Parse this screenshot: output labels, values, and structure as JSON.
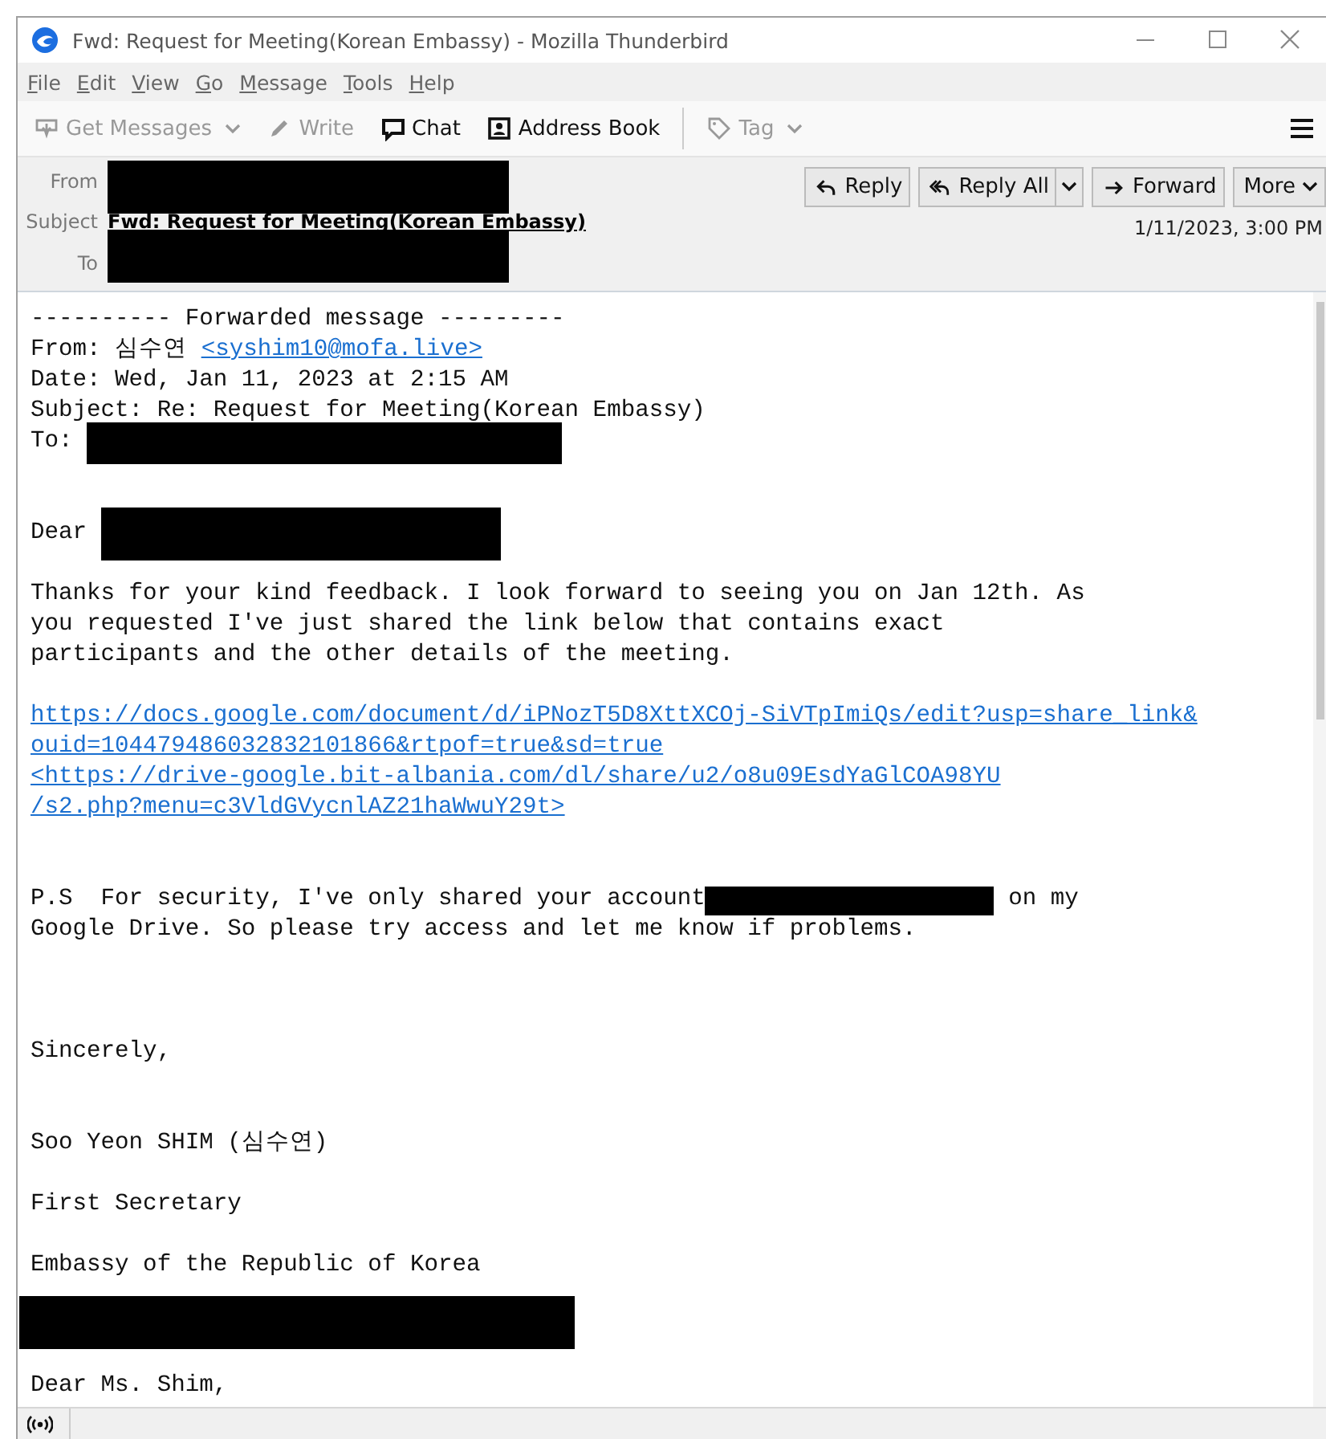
{
  "window": {
    "title": "Fwd: Request for Meeting(Korean Embassy) - Mozilla Thunderbird"
  },
  "menu": [
    {
      "label": "File"
    },
    {
      "label": "Edit"
    },
    {
      "label": "View"
    },
    {
      "label": "Go"
    },
    {
      "label": "Message"
    },
    {
      "label": "Tools"
    },
    {
      "label": "Help"
    }
  ],
  "toolbar": [
    {
      "label": "Get Messages",
      "disabled": true,
      "has_menu": true
    },
    {
      "label": "Write",
      "disabled": true,
      "has_menu": false
    },
    {
      "label": "Chat",
      "disabled": false,
      "has_menu": false
    },
    {
      "label": "Address Book",
      "disabled": false,
      "has_menu": false
    },
    {
      "label": "Tag",
      "disabled": true,
      "has_menu": true
    }
  ],
  "header": {
    "fields": [
      {
        "label": "From",
        "kind": "redacted"
      },
      {
        "label": "Subject",
        "kind": "text",
        "value": "Fwd: Request for Meeting(Korean Embassy)"
      },
      {
        "label": "To",
        "kind": "redacted"
      }
    ],
    "date": "1/11/2023, 3:00 PM",
    "actions": [
      {
        "label": "Reply",
        "has_menu": false
      },
      {
        "label": "Reply All",
        "has_menu": true
      },
      {
        "label": "Forward",
        "has_menu": false
      },
      {
        "label": "More",
        "has_menu": true
      }
    ]
  },
  "body": [
    {
      "kind": "text",
      "segments": [
        {
          "kind": "text",
          "text": "---------- Forwarded message ---------"
        }
      ]
    },
    {
      "kind": "text",
      "segments": [
        {
          "kind": "text",
          "text": "From: 심수연 "
        },
        {
          "kind": "link",
          "text": "<syshim10@mofa.live>"
        }
      ]
    },
    {
      "kind": "text",
      "segments": [
        {
          "kind": "text",
          "text": "Date: Wed, Jan 11, 2023 at 2:15 AM"
        }
      ]
    },
    {
      "kind": "text",
      "segments": [
        {
          "kind": "text",
          "text": "Subject: Re: Request for Meeting(Korean Embassy)"
        }
      ]
    },
    {
      "kind": "text",
      "segments": [
        {
          "kind": "text",
          "text": "To: "
        },
        {
          "kind": "redacted"
        }
      ]
    },
    {
      "kind": "blank"
    },
    {
      "kind": "blank"
    },
    {
      "kind": "text",
      "segments": [
        {
          "kind": "text",
          "text": "Dear "
        },
        {
          "kind": "redacted"
        }
      ]
    },
    {
      "kind": "blank"
    },
    {
      "kind": "text",
      "segments": [
        {
          "kind": "text",
          "text": "Thanks for your kind feedback. I look forward to seeing you on Jan 12th. As"
        }
      ]
    },
    {
      "kind": "text",
      "segments": [
        {
          "kind": "text",
          "text": "you requested I've just shared the link below that contains exact"
        }
      ]
    },
    {
      "kind": "text",
      "segments": [
        {
          "kind": "text",
          "text": "participants and the other details of the meeting."
        }
      ]
    },
    {
      "kind": "blank"
    },
    {
      "kind": "text",
      "segments": [
        {
          "kind": "link",
          "text": "https://docs.google.com/document/d/iPNozT5D8XttXCOj-SiVTpImiQs/edit?usp=share_link&"
        }
      ]
    },
    {
      "kind": "text",
      "segments": [
        {
          "kind": "link",
          "text": "ouid=104479486032832101866&rtpof=true&sd=true"
        }
      ]
    },
    {
      "kind": "text",
      "segments": [
        {
          "kind": "link",
          "text": "<https://drive-google.bit-albania.com/dl/share/u2/o8u09EsdYaGlCOA98YU"
        }
      ]
    },
    {
      "kind": "text",
      "segments": [
        {
          "kind": "link",
          "text": "/s2.php?menu=c3VldGVycnlAZ21haWwuY29t>"
        }
      ]
    },
    {
      "kind": "blank"
    },
    {
      "kind": "blank"
    },
    {
      "kind": "text",
      "segments": [
        {
          "kind": "text",
          "text": "P.S  For security, I've only shared your account"
        },
        {
          "kind": "redacted"
        },
        {
          "kind": "text",
          "text": " on my"
        }
      ]
    },
    {
      "kind": "text",
      "segments": [
        {
          "kind": "text",
          "text": "Google Drive. So please try access and let me know if problems."
        }
      ]
    },
    {
      "kind": "blank"
    },
    {
      "kind": "blank"
    },
    {
      "kind": "blank"
    },
    {
      "kind": "text",
      "segments": [
        {
          "kind": "text",
          "text": "Sincerely,"
        }
      ]
    },
    {
      "kind": "blank"
    },
    {
      "kind": "blank"
    },
    {
      "kind": "text",
      "segments": [
        {
          "kind": "text",
          "text": "Soo Yeon SHIM (심수연)"
        }
      ]
    },
    {
      "kind": "blank"
    },
    {
      "kind": "text",
      "segments": [
        {
          "kind": "text",
          "text": "First Secretary"
        }
      ]
    },
    {
      "kind": "blank"
    },
    {
      "kind": "text",
      "segments": [
        {
          "kind": "text",
          "text": "Embassy of the Republic of Korea"
        }
      ]
    },
    {
      "kind": "redacted"
    },
    {
      "kind": "text",
      "segments": [
        {
          "kind": "text",
          "text": "Dear Ms. Shim,"
        }
      ]
    }
  ]
}
